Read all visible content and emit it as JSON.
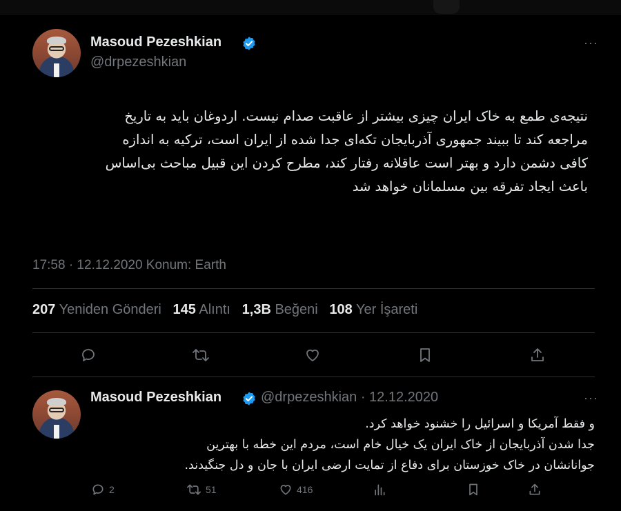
{
  "main_tweet": {
    "author_name": "Masoud Pezeshkian",
    "handle": "@drpezeshkian",
    "text_lines": [
      "نتیجه‌ی طمع به خاک ایران چیزی بیشتر از عاقبت صدام نیست. اردوغان باید به تاریخ",
      "مراجعه کند تا ببیند جمهوری آذربایجان تکه‌ای جدا شده از ایران است، ترکیه به اندازه",
      "کافی دشمن دارد و بهتر است عاقلانه رفتار کند، مطرح کردن این قبیل مباحث بی‌اساس",
      "باعث ایجاد تفرقه بین مسلمانان خواهد شد"
    ],
    "meta": "17:58 · 12.12.2020 Konum: Earth",
    "stats": {
      "retweets_count": "207",
      "retweets_label": "Yeniden Gönderi",
      "quotes_count": "145",
      "quotes_label": "Alıntı",
      "likes_count": "1,3B",
      "likes_label": "Beğeni",
      "bookmarks_count": "108",
      "bookmarks_label": "Yer İşareti"
    },
    "actions": [
      "reply-icon",
      "retweet-icon",
      "like-icon",
      "bookmark-icon",
      "share-icon"
    ]
  },
  "reply_tweet": {
    "author_name": "Masoud Pezeshkian",
    "handle_date": "@drpezeshkian · 12.12.2020",
    "text_lines": [
      "و فقط آمریکا و اسرائیل را خشنود خواهد کرد.",
      "جدا شدن آذربایجان از خاک ایران یک خیال خام است، مردم این خطه با بهترین",
      "جوانانشان در خاک خوزستان برای دفاع از تمایت ارضی ایران با جان و دل جنگیدند."
    ],
    "reply_count": "2",
    "retweet_count": "51",
    "like_count": "416",
    "actions": [
      "reply-icon",
      "retweet-icon",
      "like-icon",
      "views-icon",
      "bookmark-icon",
      "share-icon"
    ]
  },
  "colors": {
    "background": "#000000",
    "text": "#e7e9ea",
    "secondary": "#71767b",
    "verified": "#1d9bf0",
    "divider": "#2f3336"
  }
}
